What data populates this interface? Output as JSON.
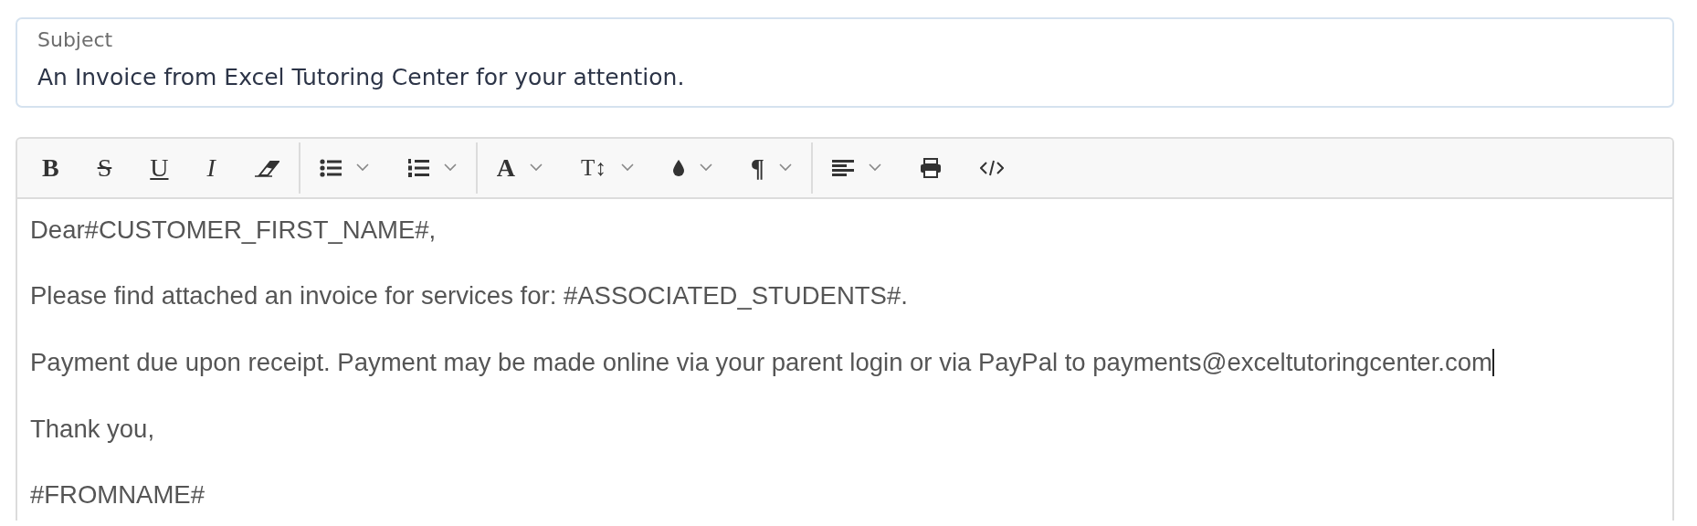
{
  "subject": {
    "label": "Subject",
    "value": "An Invoice from Excel Tutoring Center for your attention."
  },
  "toolbar": [
    [
      {
        "kind": "bold",
        "glyph": "B",
        "dropdown": false
      },
      {
        "kind": "strike",
        "glyph": "S",
        "dropdown": false
      },
      {
        "kind": "underline",
        "glyph": "U",
        "dropdown": false
      },
      {
        "kind": "italic",
        "glyph": "I",
        "dropdown": false
      },
      {
        "kind": "eraser",
        "dropdown": false
      }
    ],
    [
      {
        "kind": "bullet-list",
        "dropdown": true
      },
      {
        "kind": "numbered-list",
        "dropdown": true
      }
    ],
    [
      {
        "kind": "font",
        "glyph": "A",
        "dropdown": true
      },
      {
        "kind": "font-size",
        "glyph": "T↕",
        "dropdown": true
      },
      {
        "kind": "color",
        "dropdown": true
      },
      {
        "kind": "paragraph",
        "glyph": "¶",
        "dropdown": true
      }
    ],
    [
      {
        "kind": "align",
        "dropdown": true
      },
      {
        "kind": "print",
        "dropdown": false
      },
      {
        "kind": "code",
        "dropdown": false
      }
    ]
  ],
  "body": [
    {
      "text": "Dear#CUSTOMER_FIRST_NAME#,",
      "cursor": false
    },
    {
      "text": "Please find attached an invoice for services for: #ASSOCIATED_STUDENTS#.",
      "cursor": false
    },
    {
      "text": "Payment due upon receipt. Payment may be made online via your parent login or via PayPal to payments@exceltutoringcenter.com",
      "cursor": true
    },
    {
      "text": "Thank you,",
      "cursor": false
    },
    {
      "text": "#FROMNAME#",
      "cursor": false
    }
  ]
}
